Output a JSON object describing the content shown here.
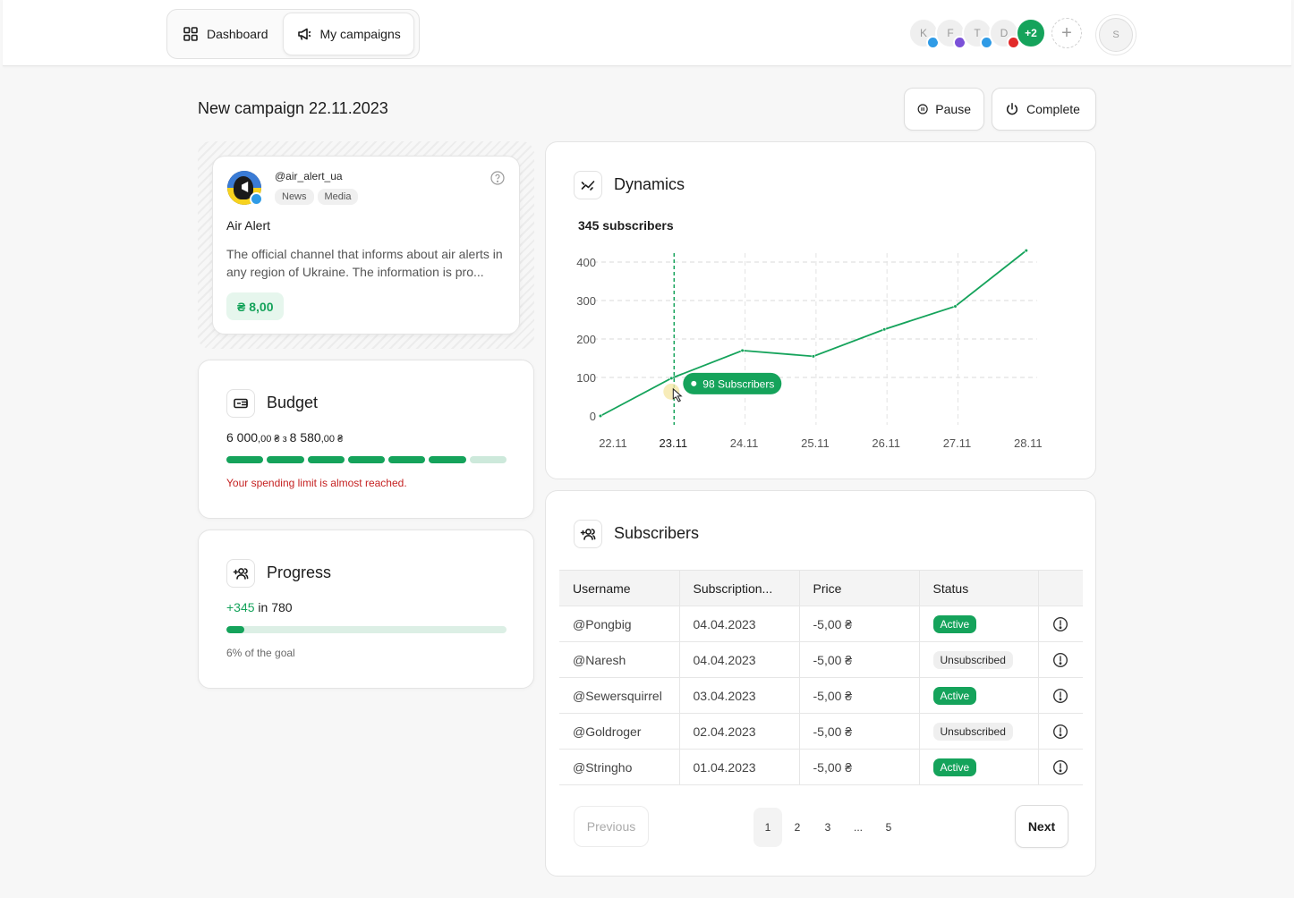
{
  "nav": {
    "dashboard_label": "Dashboard",
    "campaigns_label": "My campaigns"
  },
  "channels": {
    "avatars": [
      {
        "letter": "K",
        "network": "telegram",
        "color": "#2f9be6"
      },
      {
        "letter": "F",
        "network": "viber",
        "color": "#7b51d8"
      },
      {
        "letter": "T",
        "network": "twitter",
        "color": "#2f9be6"
      },
      {
        "letter": "D",
        "network": "youtube",
        "color": "#e22a2a"
      }
    ],
    "more_label": "+2",
    "add_label": "+"
  },
  "profile": {
    "initial": "S"
  },
  "page": {
    "title": "New campaign 22.11.2023",
    "pause_label": "Pause",
    "complete_label": "Complete"
  },
  "channel_card": {
    "handle": "@air_alert_ua",
    "tags": [
      "News",
      "Media"
    ],
    "name": "Air Alert",
    "description": "The official channel that informs about air alerts in any region of Ukraine. The information is pro...",
    "price": "₴ 8,00"
  },
  "budget": {
    "title": "Budget",
    "spent": "6 000",
    "spent_decimals": ",00 ₴",
    "separator": " з ",
    "total": "8 580",
    "total_decimals": ",00 ₴",
    "segments_filled": 6,
    "segments_total": 7,
    "warning": "Your spending limit is almost reached."
  },
  "progress": {
    "title": "Progress",
    "gained": "+345",
    "suffix": " in 780",
    "fraction": 0.065,
    "goal_text": "6% of the goal"
  },
  "dynamics": {
    "title": "Dynamics",
    "subscribers_text": "345 subscribers",
    "tooltip": "98 Subscribers",
    "highlight_category": "23.11"
  },
  "chart_data": {
    "type": "line",
    "categories": [
      "22.11",
      "23.11",
      "24.11",
      "25.11",
      "26.11",
      "27.11",
      "28.11"
    ],
    "values": [
      0,
      98,
      170,
      155,
      225,
      285,
      430
    ],
    "ylim": [
      0,
      400
    ],
    "yticks": [
      0,
      100,
      200,
      300,
      400
    ],
    "grid": true,
    "color": "#15a35b"
  },
  "subscribers": {
    "title": "Subscribers",
    "columns": [
      "Username",
      "Subscription...",
      "Price",
      "Status",
      ""
    ],
    "rows": [
      {
        "user": "@Pongbig",
        "date": "04.04.2023",
        "price": "-5,00 ₴",
        "status": "Active"
      },
      {
        "user": "@Naresh",
        "date": "04.04.2023",
        "price": "-5,00 ₴",
        "status": "Unsubscribed"
      },
      {
        "user": "@Sewersquirrel",
        "date": "03.04.2023",
        "price": "-5,00 ₴",
        "status": "Active"
      },
      {
        "user": "@Goldroger",
        "date": "02.04.2023",
        "price": "-5,00 ₴",
        "status": "Unsubscribed"
      },
      {
        "user": "@Stringho",
        "date": "01.04.2023",
        "price": "-5,00 ₴",
        "status": "Active"
      }
    ]
  },
  "pagination": {
    "previous_label": "Previous",
    "next_label": "Next",
    "pages": [
      "1",
      "2",
      "3",
      "...",
      "5"
    ],
    "current": "1"
  },
  "colors": {
    "accent": "#15a35b",
    "warning": "#c52222"
  }
}
